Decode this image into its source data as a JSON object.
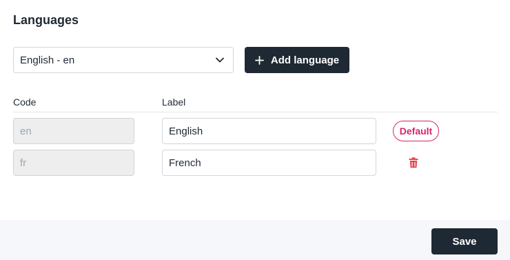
{
  "section": {
    "title": "Languages"
  },
  "language_select": {
    "selected": "English - en",
    "icon": "chevron-down-icon"
  },
  "add_language_button": {
    "label": "Add language",
    "icon": "plus-icon"
  },
  "table": {
    "columns": [
      "Code",
      "Label"
    ],
    "rows": [
      {
        "code": "en",
        "label": "English",
        "badge": "Default"
      },
      {
        "code": "fr",
        "label": "French",
        "action_icon": "trash-icon"
      }
    ]
  },
  "footer": {
    "save_label": "Save"
  },
  "colors": {
    "primary_button": "#1f2933",
    "default_badge": "#d5246a",
    "delete_icon": "#e5484d",
    "footer_bg": "#f5f7fa",
    "readonly_field_bg": "#eeeeee"
  }
}
